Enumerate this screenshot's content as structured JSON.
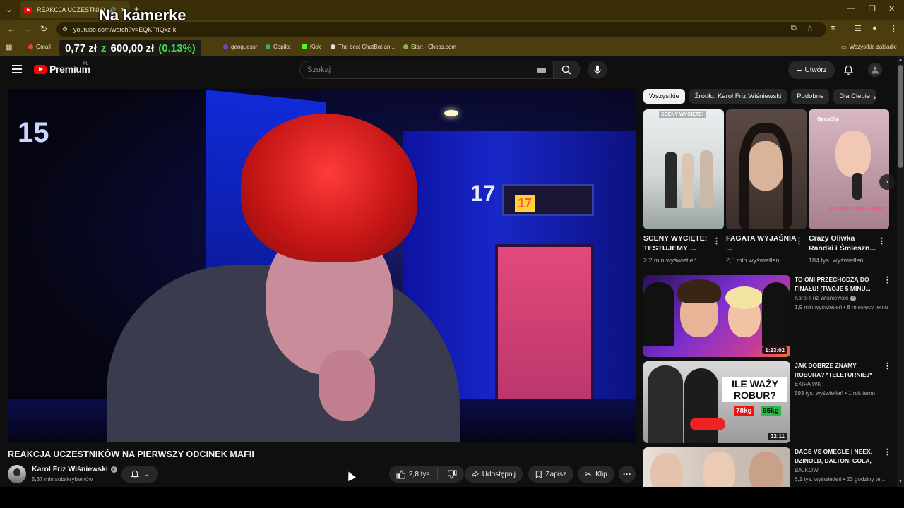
{
  "overlay": {
    "title": "Na kamerke",
    "balance_prefix": "0,77 zł",
    "z_mark": "z",
    "amount": "600,00 zł",
    "percent": "(0.13%)"
  },
  "browser": {
    "tab_title": "REAKCJA UCZESTNIKÓW N...",
    "url": "youtube.com/watch?v=EQKFfIQxz-k",
    "bookmarks": [
      {
        "label": "Gmail",
        "color": "#ea4335"
      },
      {
        "label": "geoguessr",
        "color": "#7a3fd0"
      },
      {
        "label": "Copilot",
        "color": "#2bb673"
      },
      {
        "label": "Kick",
        "color": "#53fc18"
      },
      {
        "label": "The best ChatBot an...",
        "color": "#dddddd"
      },
      {
        "label": "Start - Chess.com",
        "color": "#81b64c"
      }
    ],
    "all_bookmarks": "Wszystkie zakładki"
  },
  "yt": {
    "logo_text": "Premium",
    "region": "PL",
    "search_placeholder": "Szukaj",
    "create_label": "Utwórz"
  },
  "video": {
    "title": "REAKCJA UCZESTNIKÓW NA PIERWSZY ODCINEK MAFII",
    "channel": "Karol Friz Wiśniewski",
    "subscribers": "5,37 mln subskrybentów",
    "likes": "2,8 tys.",
    "share_label": "Udostępnij",
    "save_label": "Zapisz",
    "clip_label": "Klip"
  },
  "chips": [
    "Wszystkie",
    "Źródło: Karol Friz Wiśniewski",
    "Podobne",
    "Dla Ciebie"
  ],
  "shorts": [
    {
      "title": "SCENY WYCIĘTE: TESTUJEMY ...",
      "views": "2,2 mln wyświetleń",
      "badge": "SCENY WYCIĘTE!"
    },
    {
      "title": "FAGATA WYJAŚNIA ...",
      "views": "2,5 mln wyświetleń"
    },
    {
      "title": "Crazy Oliwka Randki i Śmieszn...",
      "views": "184 tys. wyświetleń",
      "badge": "OpusClip",
      "sticker": "zaczął w ogóle udawać"
    }
  ],
  "recommended": [
    {
      "title": "TO ONI PRZECHODZĄ DO FINAŁU! (TWOJE 5 MINU...",
      "channel": "Karol Friz Wiśniewski",
      "verified": true,
      "meta": "1,9 mln wyświetleń • 8 miesięcy temu",
      "duration": "1:23:02"
    },
    {
      "title": "JAK DOBRZE ZNAMY ROBURA? *TELETURNIEJ*",
      "channel": "EKIPA WK",
      "verified": false,
      "meta": "593 tys. wyświetleń • 1 rok temu",
      "duration": "32:11",
      "thumb_text": "ILE WAŻY ROBUR?",
      "tag1": "78kg",
      "tag2": "95kg"
    },
    {
      "title": "DAGS VS OMEGLE | NEEX, DZINOLD, DALTON, GOLA, ...",
      "channel": "BAJKOW",
      "verified": false,
      "meta": "6,1 tys. wyświetleń • 23 godziny te..."
    }
  ],
  "video_overlay_numbers": {
    "left": "15",
    "right": "17",
    "sign": "17"
  }
}
